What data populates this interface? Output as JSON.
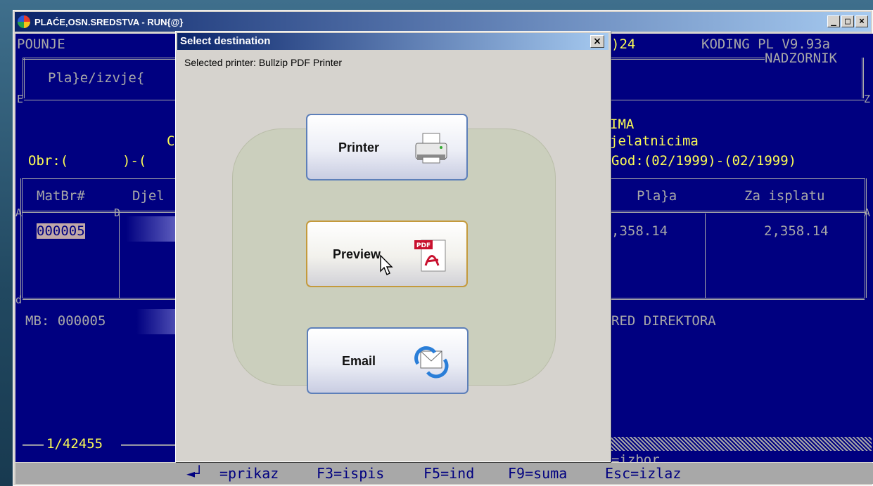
{
  "window": {
    "title": "PLAĆE,OSN.SREDSTVA - RUN{@}",
    "minimize": "_",
    "maximize": "□",
    "close": "×"
  },
  "console": {
    "top_left": "POUNJE",
    "top_right_date": ")24",
    "app_version": "KODING PL V9.93a",
    "user": "NADZORNIK",
    "menu_title": "Pla}e/izvje{",
    "left_e": "E",
    "right_z": "Z",
    "heading_char": "C",
    "heading1": "IMA",
    "heading2": "jelatnicima",
    "obr_label": "Obr:(",
    "obr_sep": ")-(",
    "god_filter": "God:(02/1999)-(02/1999)",
    "col_matbr": "MatBr#",
    "col_djel": "Djel",
    "col_placa": "Pla}a",
    "col_za_isplatu": "Za isplatu",
    "row_matbr": "000005",
    "row_placa": ",358.14",
    "row_za_isplatu": "2,358.14",
    "corner_a_left": "A",
    "corner_a_right": "A",
    "corner_d": "D",
    "corner_bottom_left": "d",
    "mb_label": "MB: 000005",
    "direktor": "RED DIREKTORA",
    "record_counter": "1/42455",
    "izbor": "=izbor"
  },
  "statusbar": {
    "enter_arrow": "◄┘",
    "prikaz": "=prikaz",
    "f3": "F3=ispis",
    "f5": "F5=ind",
    "f9": "F9=suma",
    "esc": "Esc=izlaz"
  },
  "dialog": {
    "title": "Select destination",
    "close": "×",
    "selected_printer": "Selected printer: Bullzip PDF Printer",
    "buttons": {
      "printer": "Printer",
      "preview": "Preview",
      "email": "Email"
    },
    "pdf_badge": "PDF"
  },
  "colors": {
    "console_bg": "#000080",
    "console_text": "#a8a8a8",
    "console_highlight": "#fcfc54",
    "titlebar_start": "#0a246a",
    "titlebar_end": "#a6caf0",
    "active_button_border": "#c49a3c",
    "button_border": "#5d7fb9"
  },
  "icons": [
    "printer-icon",
    "pdf-icon",
    "email-icon",
    "app-icon",
    "close-icon"
  ]
}
